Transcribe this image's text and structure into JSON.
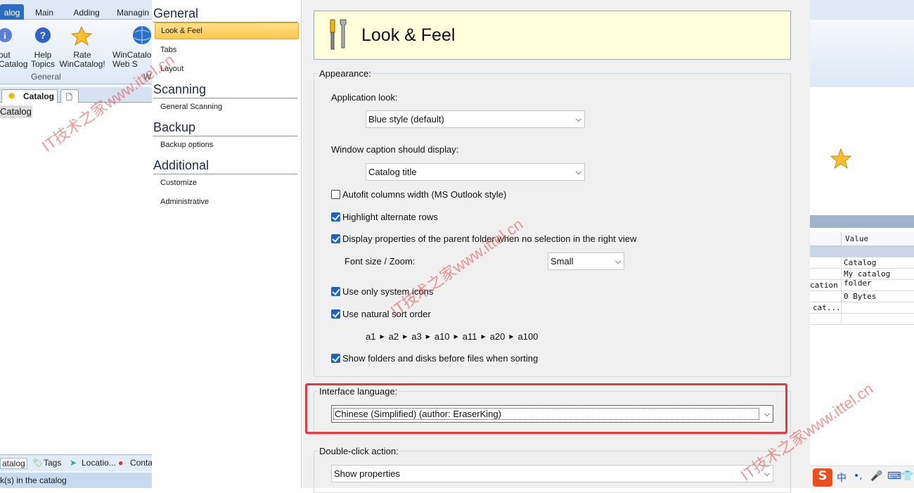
{
  "app": {
    "ribbon_tabs": [
      "alog",
      "Main",
      "Adding",
      "Managin"
    ],
    "buttons": [
      {
        "label": "out\nCatalog",
        "icon": "info-icon"
      },
      {
        "label": "Help\nTopics",
        "icon": "help-icon"
      },
      {
        "label": "Rate\nWinCatalog!",
        "icon": "star-icon"
      },
      {
        "label": "WinCatalo\nWeb S",
        "icon": "globe-icon"
      }
    ],
    "group_labels": [
      "General",
      "W"
    ],
    "doc_tab": "Catalog",
    "tree_selected": "Catalog",
    "bottom_tabs": [
      "atalog",
      "Tags",
      "Locatio...",
      "Conta"
    ],
    "status": "k(s) in the catalog"
  },
  "right_panel": {
    "grid_header": "Value",
    "rows": [
      {
        "left": "",
        "value": "Catalog"
      },
      {
        "left": "",
        "value": "My catalog folder"
      },
      {
        "left": "cation",
        "value": ""
      },
      {
        "left": "",
        "value": "0 Bytes"
      },
      {
        "left": "cat...",
        "value": ""
      },
      {
        "left": "",
        "value": ""
      }
    ]
  },
  "nav": {
    "sections": [
      {
        "title": "General",
        "items": [
          "Look & Feel",
          "Tabs",
          "Layout"
        ]
      },
      {
        "title": "Scanning",
        "items": [
          "General Scanning"
        ]
      },
      {
        "title": "Backup",
        "items": [
          "Backup options"
        ]
      },
      {
        "title": "Additional",
        "items": [
          "Customize",
          "Administrative"
        ]
      }
    ],
    "selected": "Look & Feel"
  },
  "page": {
    "title": "Look & Feel",
    "appearance_label": "Appearance:",
    "app_look_label": "Application look:",
    "app_look_value": "Blue style (default)",
    "caption_label": "Window caption should display:",
    "caption_value": "Catalog title",
    "autofit": {
      "label": "Autofit columns width (MS Outlook style)",
      "checked": false
    },
    "highlight": {
      "label": "Highlight alternate rows",
      "checked": true
    },
    "display_props": {
      "label": "Display properties of the parent folder when no selection in the right view",
      "checked": true
    },
    "font_label": "Font size / Zoom:",
    "font_value": "Small",
    "system_icons": {
      "label": "Use only system icons",
      "checked": true
    },
    "natural_sort": {
      "label": "Use natural sort order",
      "checked": true
    },
    "sort_example": [
      "a1",
      "a2",
      "a3",
      "a10",
      "a11",
      "a20",
      "a100"
    ],
    "folders_first": {
      "label": "Show folders and disks before files when sorting",
      "checked": true
    },
    "language_label": "Interface language:",
    "language_value": "Chinese (Simplified) (author: EraserKing)",
    "dblclick_label": "Double-click action:",
    "dblclick_value": "Show properties"
  },
  "watermarks": [
    "IT技术之家www.ittel.cn"
  ],
  "tray": [
    "S",
    "中",
    "•,",
    "🎤",
    "⌨",
    "👕"
  ],
  "colors": {
    "accent": "#2b6ec1",
    "highlight": "#e53b3b",
    "selection": "#fbc84a"
  }
}
